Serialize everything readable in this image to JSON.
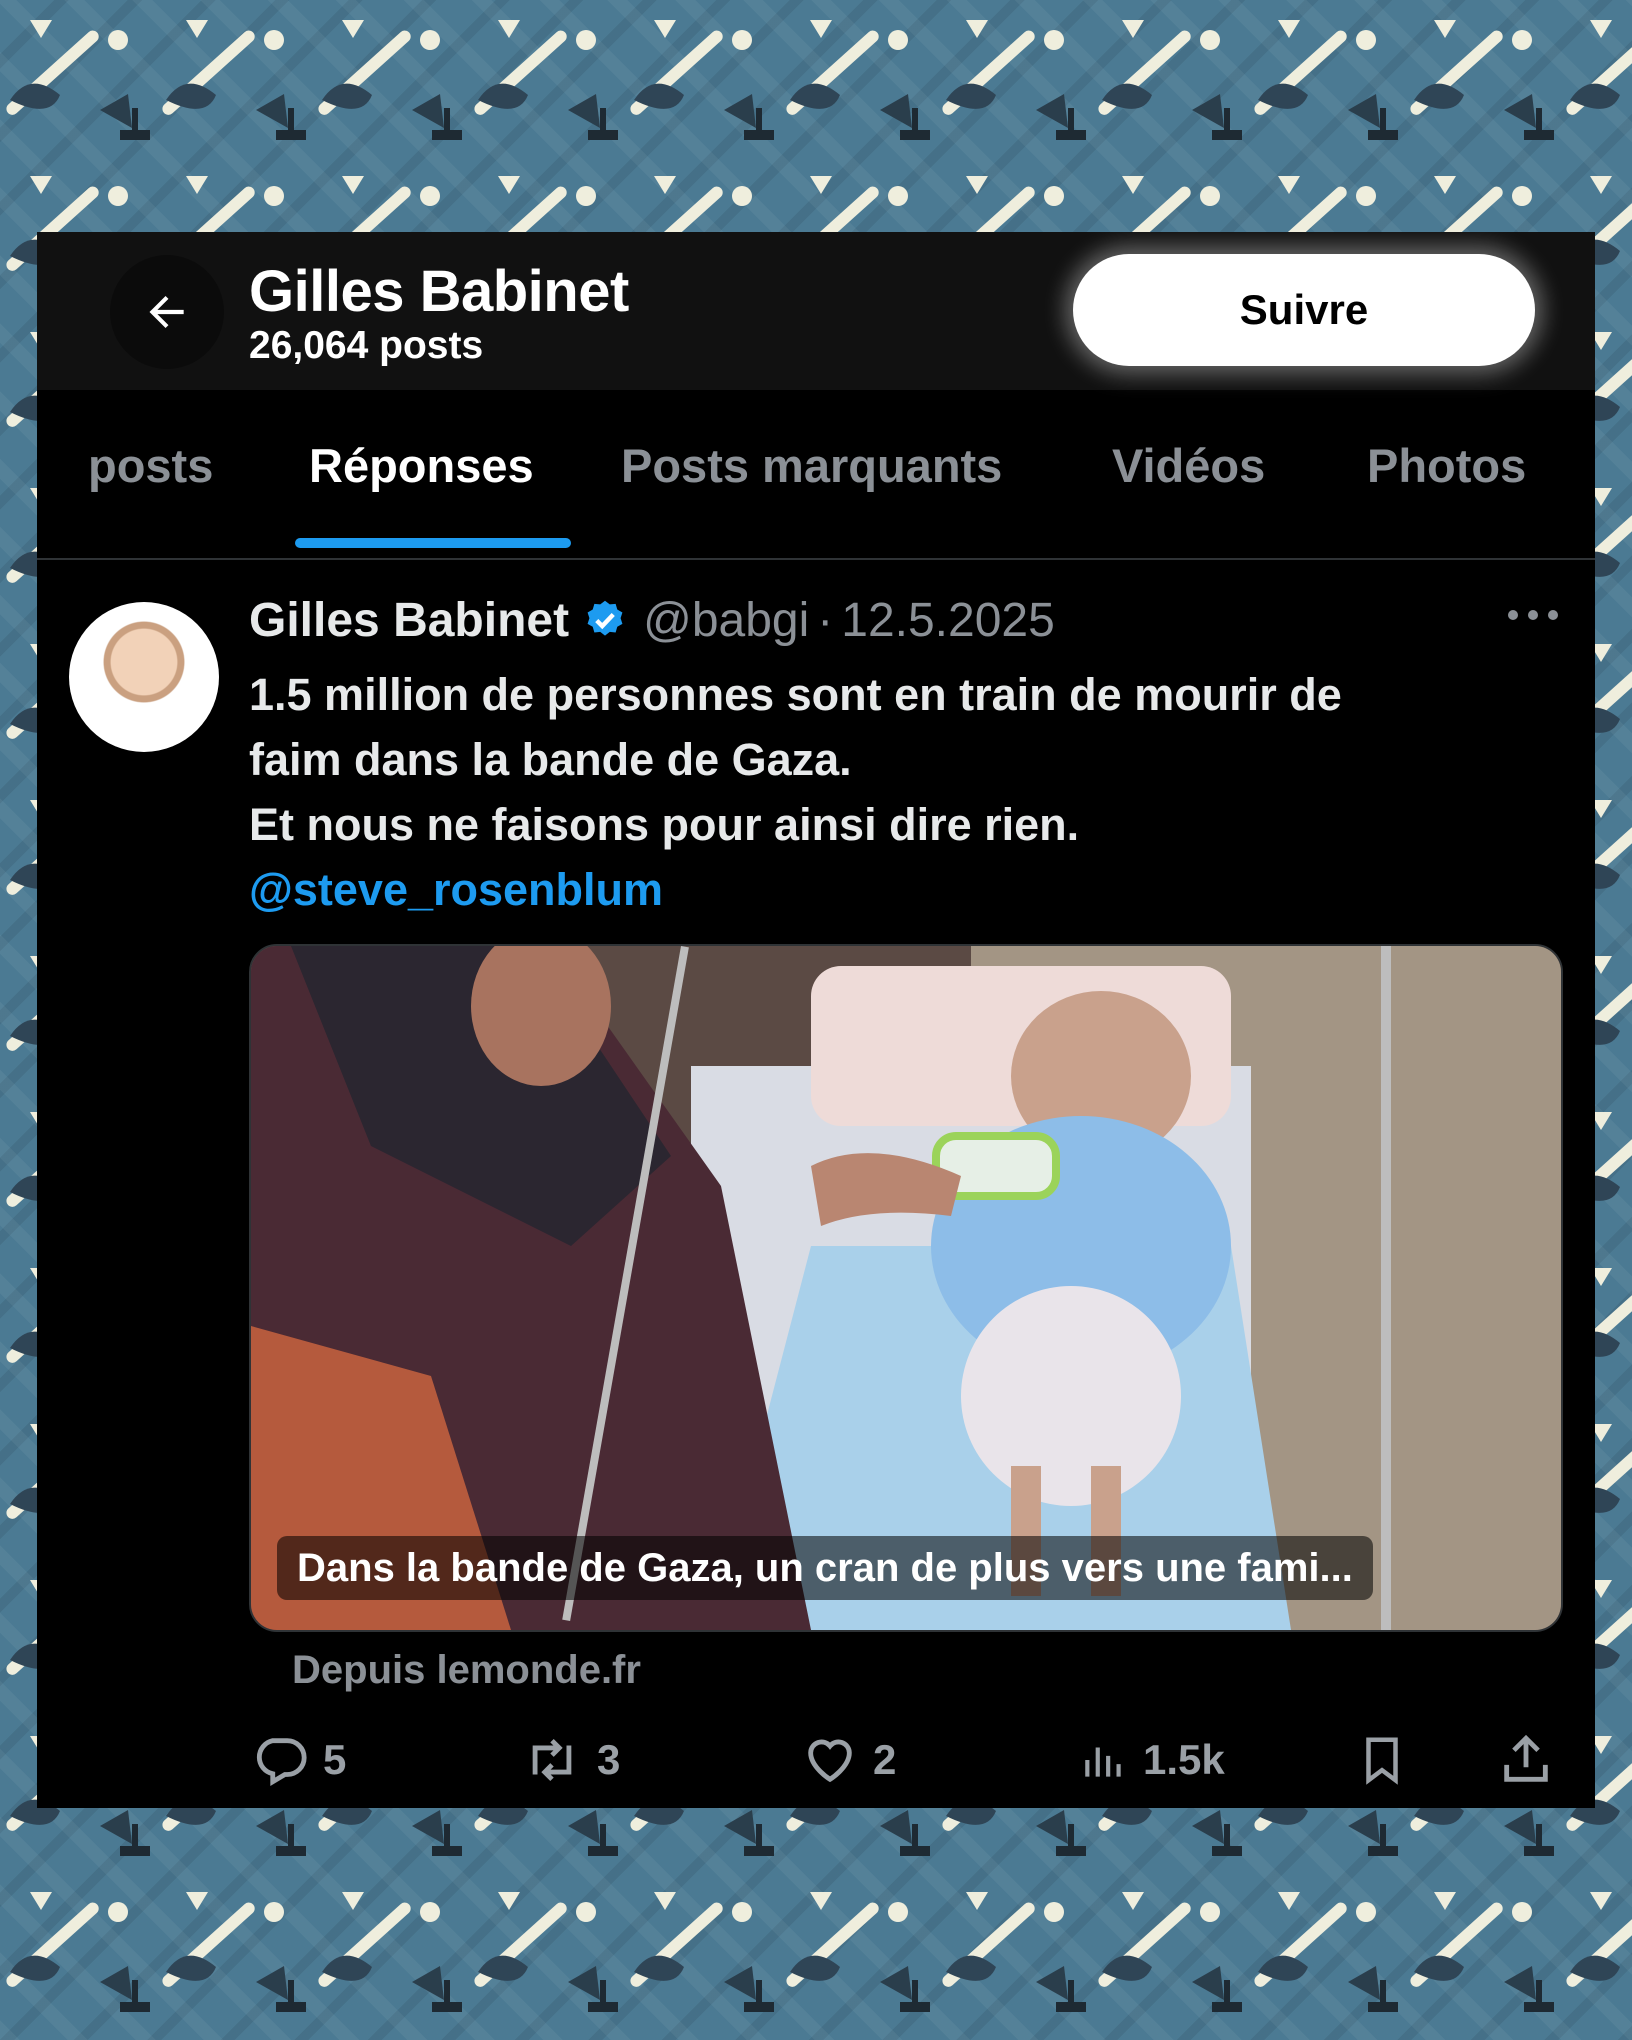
{
  "profile": {
    "name": "Gilles Babinet",
    "posts_count": "26,064 posts",
    "follow_label": "Suivre"
  },
  "tabs": [
    {
      "label": "posts"
    },
    {
      "label": "Réponses",
      "active": true
    },
    {
      "label": "Posts marquants"
    },
    {
      "label": "Vidéos"
    },
    {
      "label": "Photos"
    }
  ],
  "tweet": {
    "author": "Gilles Babinet",
    "verified": true,
    "handle": "@babgi",
    "separator": "·",
    "date": "12.5.2025",
    "text_lines": [
      "1.5 million de personnes sont en train de mourir de",
      "faim dans la bande de Gaza.",
      "Et nous ne faisons pour ainsi dire rien."
    ],
    "mention": "@steve_rosenblum",
    "link_card": {
      "caption": "Dans la bande de Gaza, un cran de plus vers une fami...",
      "source": "Depuis lemonde.fr"
    },
    "stats": {
      "replies": "5",
      "reposts": "3",
      "likes": "2",
      "views": "1.5k"
    }
  },
  "icons": {
    "back": "arrow-left-icon",
    "verified": "verified-badge-icon",
    "more": "more-dots-icon",
    "reply": "reply-icon",
    "repost": "repost-icon",
    "like": "heart-icon",
    "views": "views-icon",
    "bookmark": "bookmark-icon",
    "share": "share-icon"
  },
  "colors": {
    "background": "#4b7a93",
    "card": "#000000",
    "accent": "#1d9bf0",
    "muted_text": "#8b9096"
  }
}
